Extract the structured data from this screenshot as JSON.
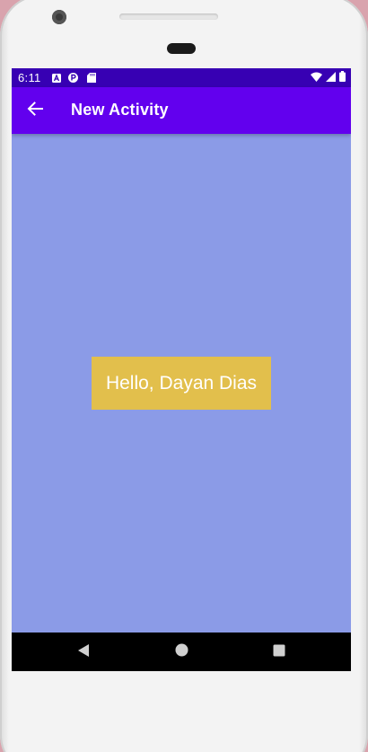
{
  "status_bar": {
    "time": "6:11",
    "notification_icons": [
      "a-icon",
      "p-icon",
      "sd-card-icon"
    ],
    "system_icons": [
      "wifi-icon",
      "signal-icon",
      "battery-icon"
    ]
  },
  "app_bar": {
    "title": "New Activity",
    "back_icon": "arrow-back-icon",
    "color": "#6200ee",
    "status_color": "#3700b3"
  },
  "content": {
    "greeting": "Hello, Dayan Dias",
    "background_color": "#8b9be7",
    "greeting_background": "#e2bf4c"
  },
  "nav_bar": {
    "buttons": [
      "back-triangle-icon",
      "home-circle-icon",
      "recents-square-icon"
    ]
  }
}
